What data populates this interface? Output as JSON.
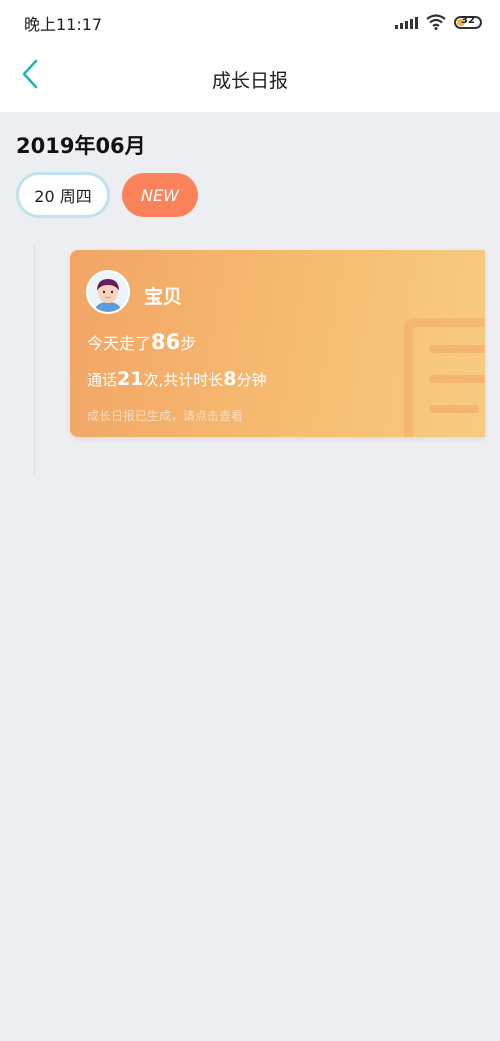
{
  "status": {
    "time": "晚上11:17",
    "battery": "32",
    "battery_level": 0.32
  },
  "nav": {
    "title": "成长日报",
    "back_icon": "chevron-left-icon",
    "accent": "#1FB8B0"
  },
  "month": "2019年06月",
  "chips": {
    "day": "20 周四",
    "new": "NEW"
  },
  "card": {
    "name": "宝贝",
    "steps_prefix": "今天走了",
    "steps_value": "86",
    "steps_suffix": "步",
    "calls_prefix": "通话",
    "calls_count": "21",
    "calls_mid": "次,共计时长",
    "calls_minutes": "8",
    "calls_suffix": "分钟",
    "hint": "成长日报已生成，请点击查看"
  }
}
